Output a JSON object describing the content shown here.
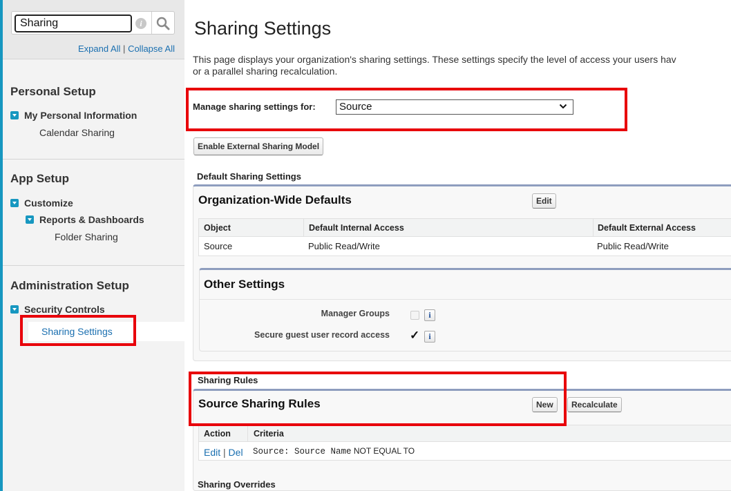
{
  "sidebar": {
    "search": {
      "value": "Sharing",
      "placeholder": ""
    },
    "expand_all": "Expand All",
    "link_separator": "|",
    "collapse_all": "Collapse All",
    "sections": [
      {
        "title": "Personal Setup",
        "items": [
          {
            "label": "My Personal Information"
          },
          {
            "label": "Calendar Sharing"
          }
        ]
      },
      {
        "title": "App Setup",
        "items": [
          {
            "label": "Customize"
          },
          {
            "label": "Reports & Dashboards"
          },
          {
            "label": "Folder Sharing"
          }
        ]
      },
      {
        "title": "Administration Setup",
        "items": [
          {
            "label": "Security Controls"
          },
          {
            "label": "Sharing Settings",
            "selected": true
          }
        ]
      }
    ]
  },
  "main": {
    "title": "Sharing Settings",
    "description_line1": "This page displays your organization's sharing settings. These settings specify the level of access your users hav",
    "description_line2": "or a parallel sharing recalculation.",
    "manage_label": "Manage sharing settings for:",
    "manage_selected": "Source",
    "enable_external_button": "Enable External Sharing Model",
    "default_sharing_heading": "Default Sharing Settings",
    "owd": {
      "title": "Organization-Wide Defaults",
      "edit_button": "Edit",
      "columns": [
        "Object",
        "Default Internal Access",
        "Default External Access"
      ],
      "rows": [
        [
          "Source",
          "Public Read/Write",
          "Public Read/Write"
        ]
      ]
    },
    "other_settings": {
      "title": "Other Settings",
      "settings": [
        {
          "label": "Manager Groups",
          "checked": false
        },
        {
          "label": "Secure guest user record access",
          "checked": true
        }
      ]
    },
    "sharing_rules_heading": "Sharing Rules",
    "source_rules": {
      "title": "Source Sharing Rules",
      "new_button": "New",
      "recalculate_button": "Recalculate",
      "columns": [
        "Action",
        "Criteria"
      ],
      "rows": [
        {
          "edit": "Edit",
          "sep": "|",
          "del": "Del",
          "criteria_field": "Source: Source Name",
          "criteria_op": "NOT EQUAL TO"
        }
      ]
    },
    "sharing_overrides_heading": "Sharing Overrides"
  },
  "colors": {
    "highlight": "#e8000a",
    "accent": "#1797c0",
    "link": "#1a6fb0",
    "panel_border": "#8e9dbe"
  }
}
